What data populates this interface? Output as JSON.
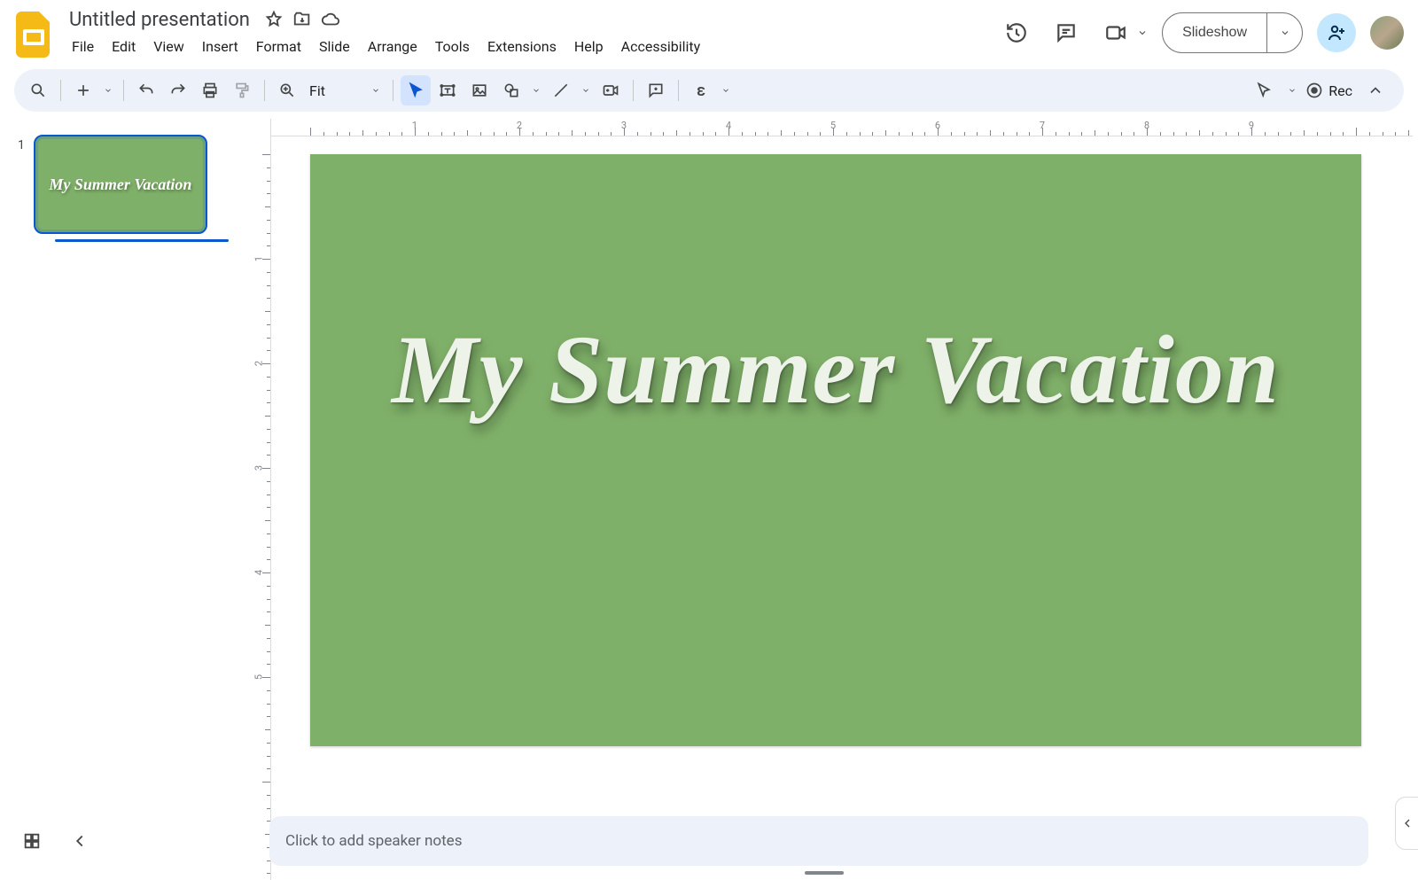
{
  "header": {
    "doc_title": "Untitled presentation",
    "menus": [
      "File",
      "Edit",
      "View",
      "Insert",
      "Format",
      "Slide",
      "Arrange",
      "Tools",
      "Extensions",
      "Help",
      "Accessibility"
    ],
    "slideshow_label": "Slideshow"
  },
  "toolbar": {
    "zoom_label": "Fit",
    "rec_label": "Rec"
  },
  "ruler": {
    "h_labels": [
      "1",
      "2",
      "3",
      "4",
      "5",
      "6",
      "7",
      "8",
      "9"
    ],
    "v_labels": [
      "1",
      "2",
      "3",
      "4",
      "5"
    ]
  },
  "slides": [
    {
      "number": "1",
      "title": "My Summer Vacation"
    }
  ],
  "canvas": {
    "title_text": "My Summer Vacation",
    "bg_color": "#7fb069"
  },
  "notes": {
    "placeholder": "Click to add speaker notes"
  }
}
